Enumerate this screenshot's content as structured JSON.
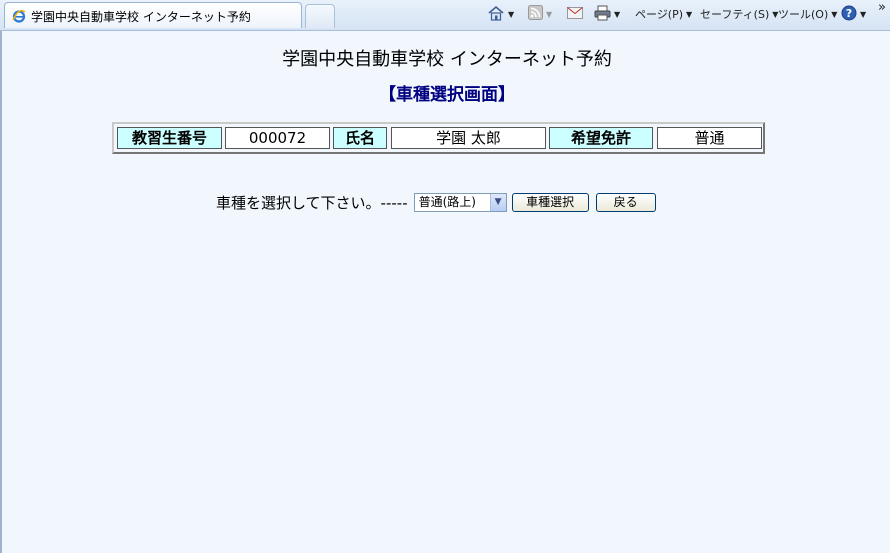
{
  "browser": {
    "tab_title": "学園中央自動車学校 インターネット予約",
    "commands": {
      "page_label": "ページ(P)",
      "safety_label": "セーフティ(S)",
      "tools_label": "ツール(O)"
    }
  },
  "page": {
    "school_title": "学園中央自動車学校 インターネット予約",
    "screen_title": "【車種選択画面】",
    "info": {
      "student_no_label": "教習生番号",
      "student_no": "000072",
      "name_label": "氏名",
      "name": "学園 太郎",
      "license_label": "希望免許",
      "license": "普通"
    },
    "prompt": "車種を選択して下さい。-----",
    "car_type_select": {
      "selected": "普通(路上)"
    },
    "select_button": "車種選択",
    "back_button": "戻る"
  },
  "colors": {
    "header_cell_bg": "#ccffff",
    "screen_title": "#000080",
    "page_bg": "#f1f7fd"
  }
}
